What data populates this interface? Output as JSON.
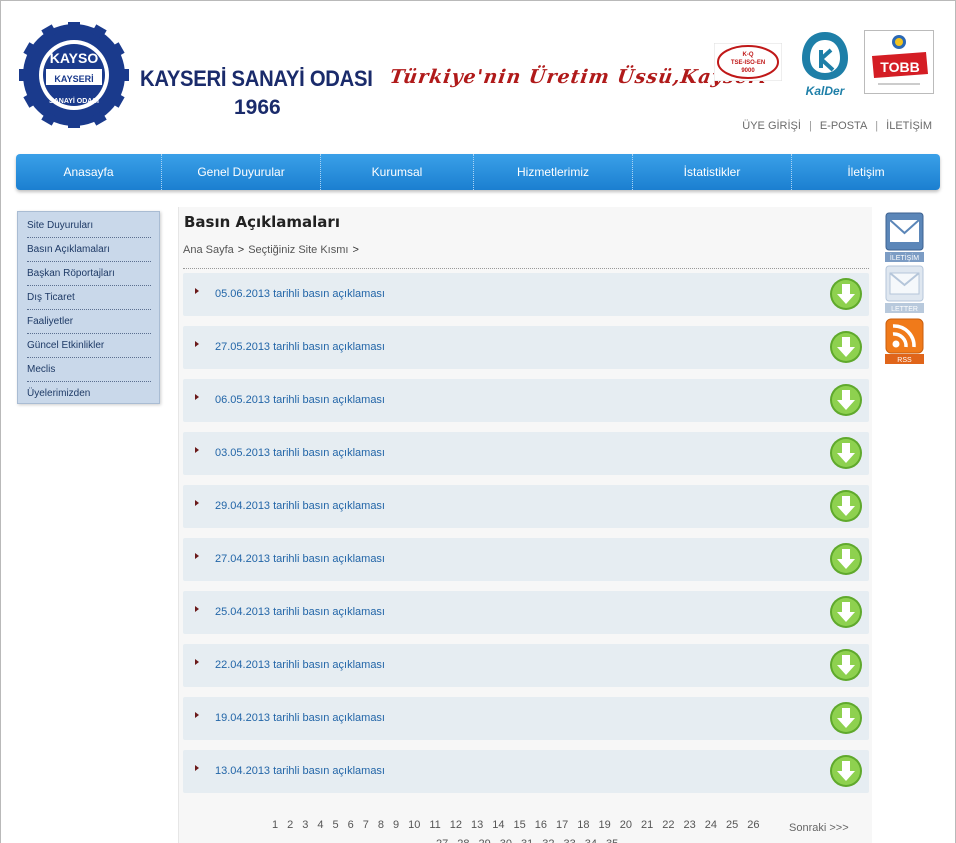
{
  "header": {
    "brand_name": "KAYSERİ SANAYİ ODASI",
    "brand_year": "1966",
    "logo_text_top": "KAYSO",
    "logo_text_ring": "SANAYİ ODASI",
    "logo_text_mid": "KAYSERİ",
    "slogan": "Türkiye'nin Üretim Üssü,Kayseri",
    "badges": {
      "tse": [
        "K-Q",
        "TSE-ISO-EN",
        "9000"
      ],
      "kalder": "KalDer",
      "tobb": "TOBB"
    },
    "top_links": [
      "ÜYE GİRİŞİ",
      "E-POSTA",
      "İLETİŞİM"
    ]
  },
  "nav": {
    "items": [
      "Anasayfa",
      "Genel Duyurular",
      "Kurumsal",
      "Hizmetlerimiz",
      "İstatistikler",
      "İletişim"
    ]
  },
  "sidebar": {
    "items": [
      "Site Duyuruları",
      "Basın Açıklamaları",
      "Başkan Röportajları",
      "Dış Ticaret",
      "Faaliyetler",
      "Güncel Etkinlikler",
      "Meclis",
      "Üyelerimizden"
    ]
  },
  "main": {
    "title": "Basın Açıklamaları",
    "breadcrumb": [
      "Ana Sayfa",
      "Seçtiğiniz Site Kısmı"
    ],
    "rows": [
      "05.06.2013 tarihli basın açıklaması",
      "27.05.2013 tarihli basın açıklaması",
      "06.05.2013 tarihli basın açıklaması",
      "03.05.2013 tarihli basın açıklaması",
      "29.04.2013 tarihli basın açıklaması",
      "27.04.2013 tarihli basın açıklaması",
      "25.04.2013 tarihli basın açıklaması",
      "22.04.2013 tarihli basın açıklaması",
      "19.04.2013 tarihli basın açıklaması",
      "13.04.2013 tarihli basın açıklaması"
    ]
  },
  "pager": {
    "pages": [
      "1",
      "2",
      "3",
      "4",
      "5",
      "6",
      "7",
      "8",
      "9",
      "10",
      "11",
      "12",
      "13",
      "14",
      "15",
      "16",
      "17",
      "18",
      "19",
      "20",
      "21",
      "22",
      "23",
      "24",
      "25",
      "26",
      "27",
      "28",
      "29",
      "30",
      "31",
      "32",
      "33",
      "34",
      "35"
    ],
    "next_label": "Sonraki >>>"
  },
  "right_icons": {
    "iletisim": "İLETİŞİM",
    "letter": "LETTER",
    "rss": "RSS"
  },
  "colors": {
    "nav_blue": "#1b7fd0",
    "brand_navy": "#1a2b6b",
    "slogan_red": "#b01a1a",
    "link_blue": "#2366a8",
    "download_green": "#7cc243"
  }
}
